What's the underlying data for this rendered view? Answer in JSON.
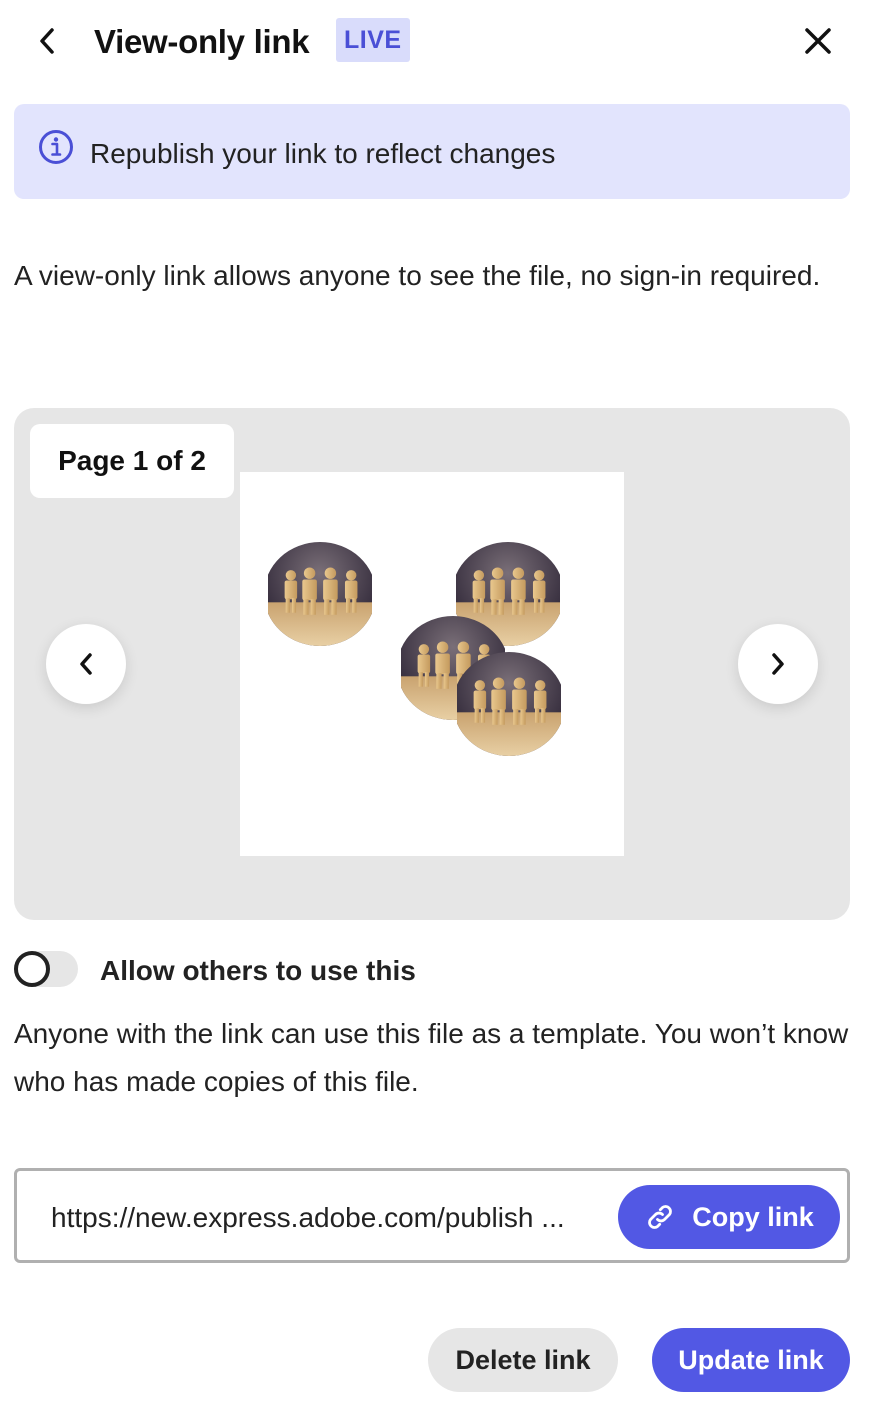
{
  "header": {
    "title": "View-only link",
    "badge": "LIVE",
    "back_icon": "chevron-left-icon",
    "close_icon": "close-icon"
  },
  "banner": {
    "icon": "info-icon",
    "text": "Republish your link to reflect changes"
  },
  "description": "A view-only link allows anyone to see the file, no sign-in required.",
  "preview": {
    "page_indicator": "Page 1 of 2",
    "prev_icon": "chevron-left-icon",
    "next_icon": "chevron-right-icon",
    "thumbnail": "wooden-figures-circles-collage"
  },
  "allow_others": {
    "label": "Allow others to use this",
    "enabled": false,
    "description": "Anyone with the link can use this file as a template. You won’t know who has made copies of this file."
  },
  "link": {
    "url": "https://new.express.adobe.com/publish ...",
    "copy_label": "Copy link",
    "copy_icon": "link-icon"
  },
  "actions": {
    "delete_label": "Delete link",
    "update_label": "Update link"
  },
  "colors": {
    "accent": "#5258e4",
    "banner_bg": "#e2e4fd",
    "badge_bg": "#d9dcfb",
    "badge_text": "#4a4fd6",
    "neutral_bg": "#e6e6e6"
  }
}
